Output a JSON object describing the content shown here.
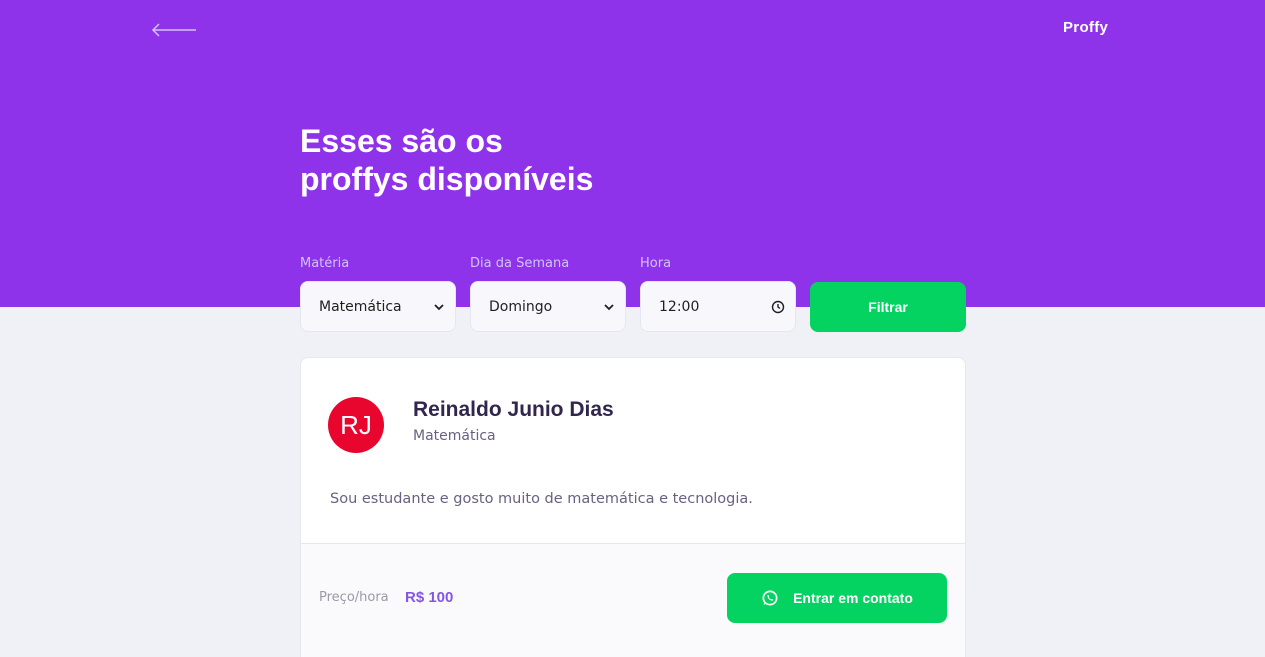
{
  "header": {
    "logo": "Proffy",
    "title_line1": "Esses são os",
    "title_line2": "proffys disponíveis"
  },
  "filters": {
    "subject": {
      "label": "Matéria",
      "value": "Matemática"
    },
    "weekday": {
      "label": "Dia da Semana",
      "value": "Domingo"
    },
    "time": {
      "label": "Hora",
      "value": "12:00"
    },
    "submit_label": "Filtrar"
  },
  "teacher": {
    "initials": "RJ",
    "name": "Reinaldo Junio Dias",
    "subject": "Matemática",
    "bio": "Sou estudante e gosto muito de matemática e tecnologia.",
    "price_label": "Preço/hora",
    "price_value": "R$ 100",
    "contact_label": "Entrar em contato"
  },
  "icons": {
    "back": "back-arrow-icon",
    "select": "chevron-down-icon",
    "time": "clock-icon",
    "contact": "whatsapp-icon"
  },
  "colors": {
    "primary": "#8F33EB",
    "secondary": "#04D361",
    "background": "#F0F0F7",
    "avatar": "#E8062E",
    "price": "#8257E5"
  }
}
